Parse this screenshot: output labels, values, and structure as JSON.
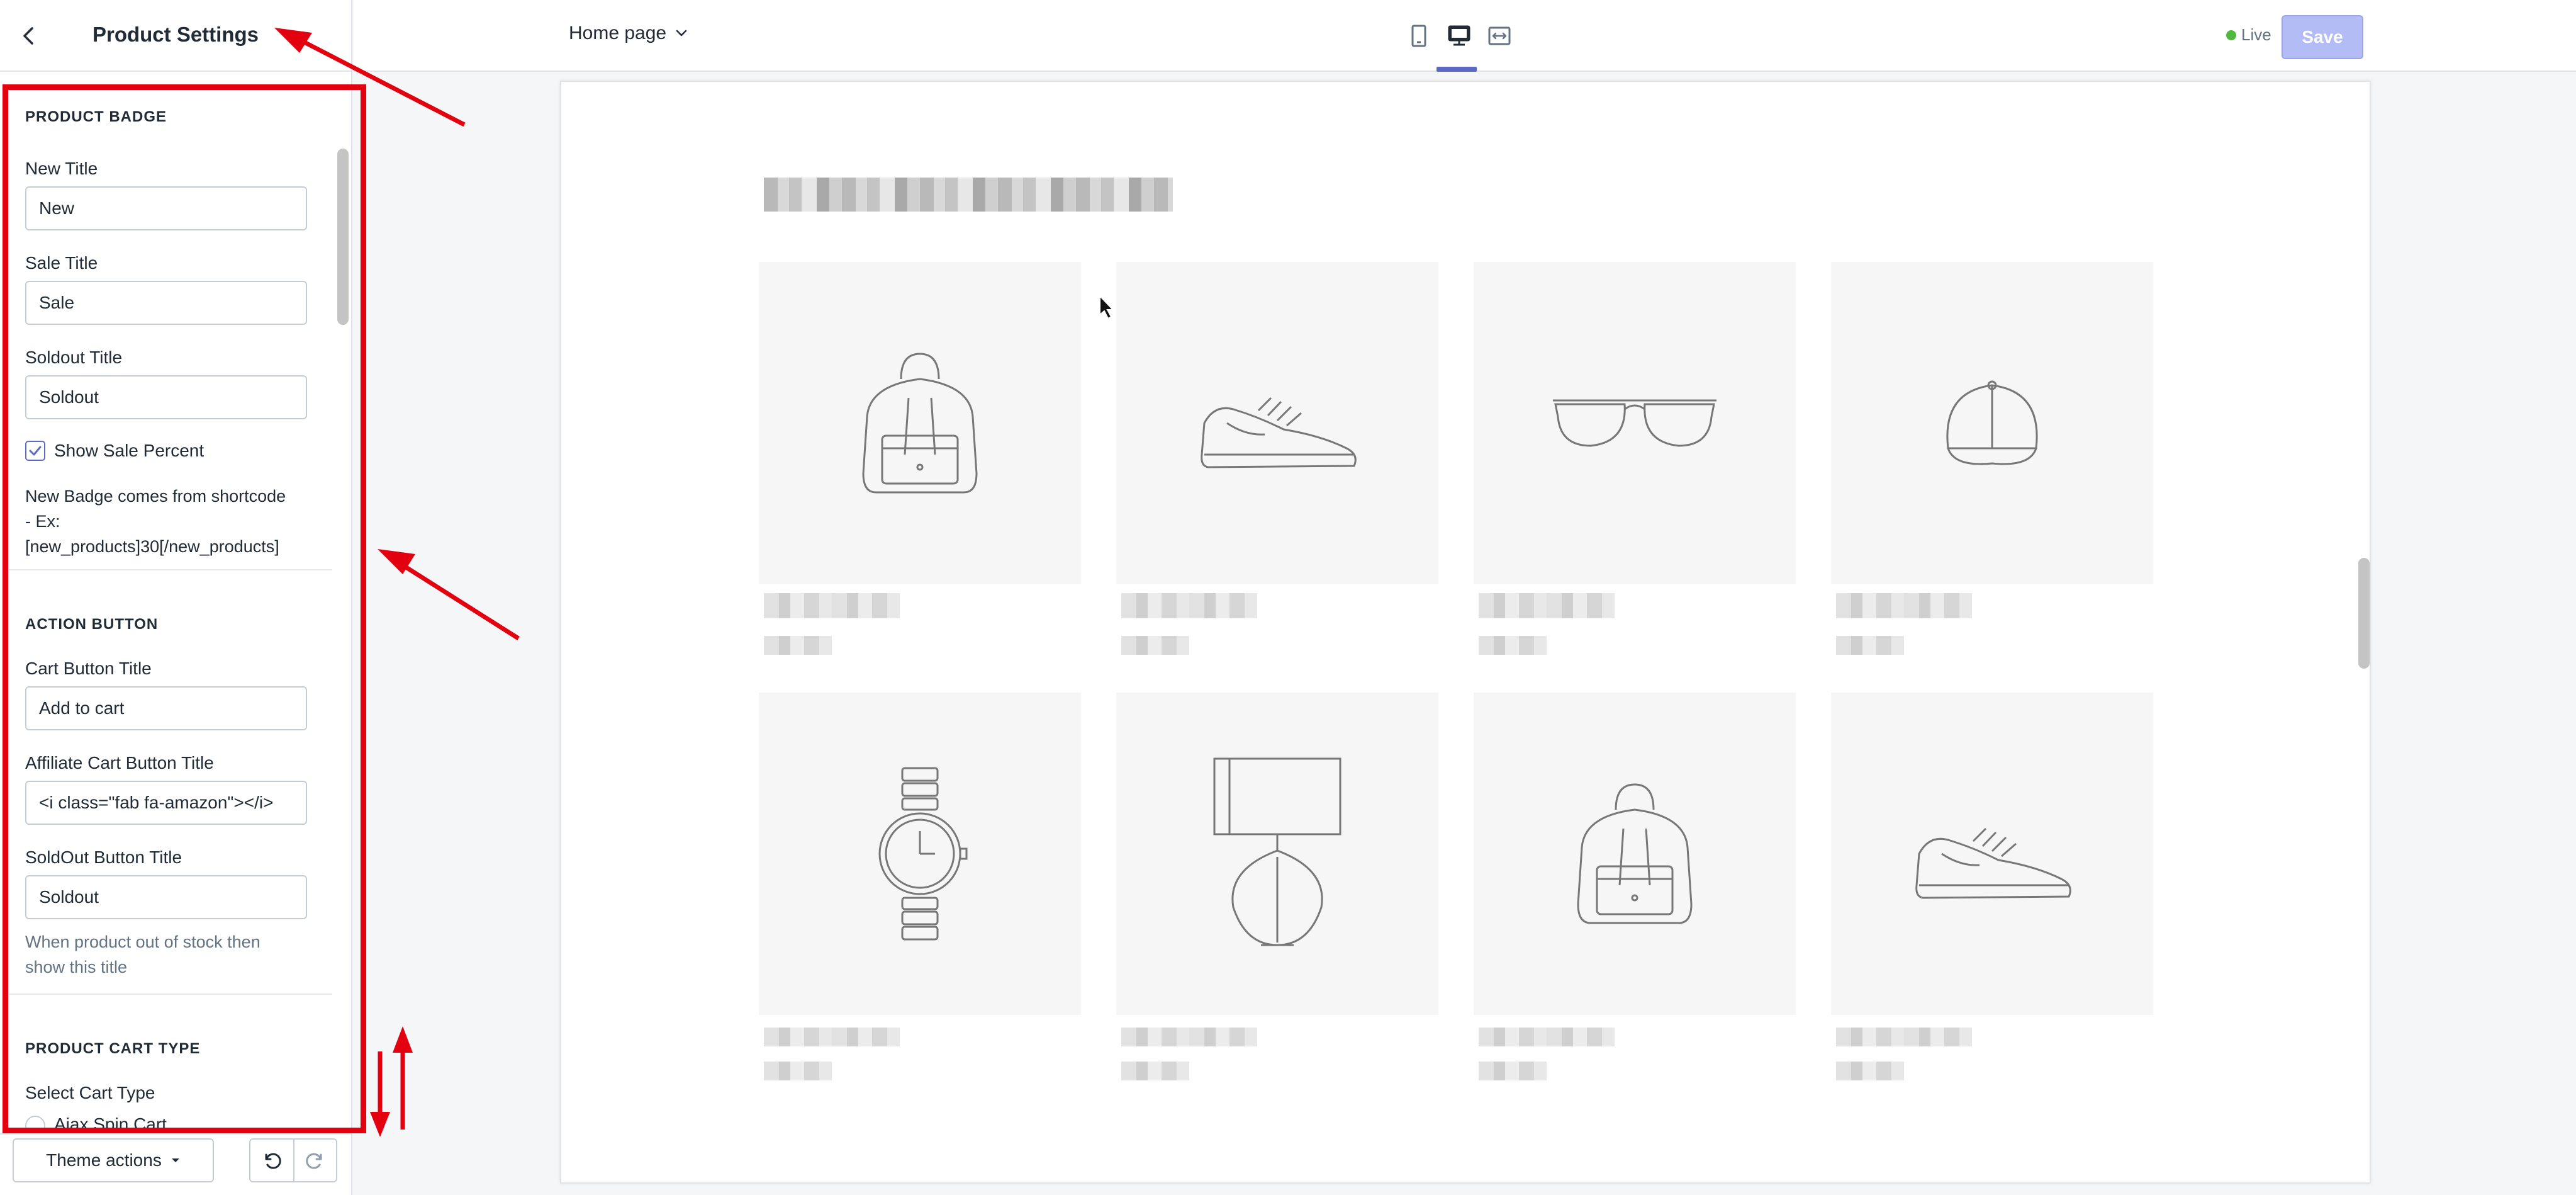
{
  "sidebar": {
    "title": "Product Settings",
    "sections": {
      "badge": {
        "title": "PRODUCT BADGE",
        "new_label": "New Title",
        "new_value": "New",
        "sale_label": "Sale Title",
        "sale_value": "Sale",
        "soldout_label": "Soldout Title",
        "soldout_value": "Soldout",
        "checkbox_label": "Show Sale Percent",
        "checkbox_checked": true,
        "info_line1": "New Badge comes from shortcode",
        "info_line2": "- Ex:",
        "info_line3": "[new_products]30[/new_products]"
      },
      "action": {
        "title": "ACTION BUTTON",
        "cart_label": "Cart Button Title",
        "cart_value": "Add to cart",
        "affiliate_label": "Affiliate Cart Button Title",
        "affiliate_value": "<i class=\"fab fa-amazon\"></i>",
        "soldout_label": "SoldOut Button Title",
        "soldout_value": "Soldout",
        "help_line1": "When product out of stock then",
        "help_line2": "show this title"
      },
      "cart_type": {
        "title": "PRODUCT CART TYPE",
        "select_label": "Select Cart Type",
        "option1": "Ajax Spin Cart"
      }
    },
    "footer": {
      "theme_actions": "Theme actions"
    }
  },
  "topbar": {
    "page_select": "Home page",
    "live_label": "Live",
    "save_label": "Save"
  },
  "preview": {
    "row1_icons": [
      "backpack-icon",
      "sneaker-icon",
      "sunglasses-icon",
      "cap-icon"
    ],
    "row2_icons": [
      "watch-icon",
      "lamp-icon",
      "backpack-icon",
      "sneaker-icon"
    ]
  },
  "colors": {
    "accent": "#5c6ac4",
    "save_disabled": "#b3bcf5",
    "live_dot": "#50b83c",
    "annotation_red": "#e3000f"
  }
}
